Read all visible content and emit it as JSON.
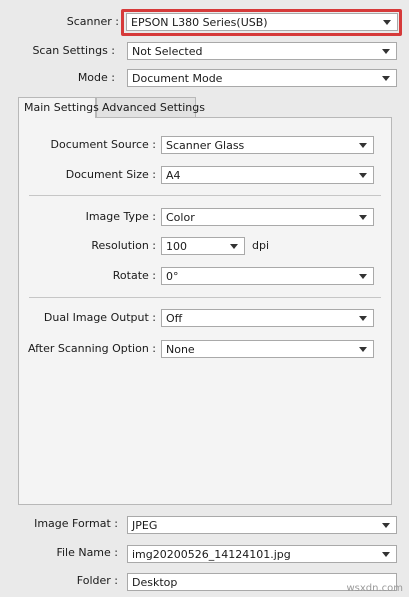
{
  "scanner": {
    "label": "Scanner :",
    "value": "EPSON L380 Series(USB)"
  },
  "scan_settings": {
    "label": "Scan Settings :",
    "value": "Not Selected"
  },
  "mode": {
    "label": "Mode :",
    "value": "Document Mode"
  },
  "tabs": {
    "main": "Main Settings",
    "advanced": "Advanced Settings"
  },
  "main": {
    "document_source": {
      "label": "Document Source :",
      "value": "Scanner Glass"
    },
    "document_size": {
      "label": "Document Size :",
      "value": "A4"
    },
    "image_type": {
      "label": "Image Type :",
      "value": "Color"
    },
    "resolution": {
      "label": "Resolution :",
      "value": "100",
      "unit": "dpi"
    },
    "rotate": {
      "label": "Rotate :",
      "value": "0°"
    },
    "dual_image_output": {
      "label": "Dual Image Output :",
      "value": "Off"
    },
    "after_scanning": {
      "label": "After Scanning Option :",
      "value": "None"
    }
  },
  "image_format": {
    "label": "Image Format :",
    "value": "JPEG"
  },
  "file_name": {
    "label": "File Name :",
    "value": "img20200526_14124101.jpg"
  },
  "folder": {
    "label": "Folder :",
    "value": "Desktop"
  },
  "watermark": "wsxdn.com",
  "colors": {
    "highlight": "#d63a3a",
    "panel": "#f4f4f4",
    "background": "#eaeaea"
  }
}
